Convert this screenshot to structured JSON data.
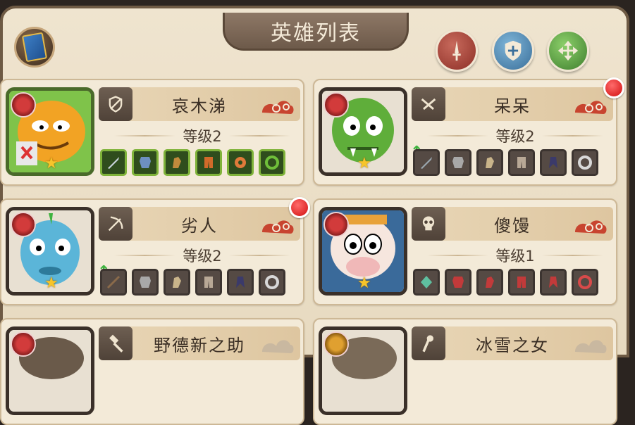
{
  "window": {
    "title": "英雄列表"
  },
  "colors": {
    "accent_green": "#7fb33a",
    "alert_red": "#d10f0f",
    "star": "#f7c52b"
  },
  "toolbar": {
    "buttons": [
      {
        "icon": "sword-icon"
      },
      {
        "icon": "shield-icon"
      },
      {
        "icon": "move-arrows-icon"
      }
    ]
  },
  "heroes": [
    {
      "name": "哀木涕",
      "level": "等级2",
      "class_icon": "shield-class-icon",
      "stars": 1,
      "new": false,
      "items": [
        "sword-item",
        "armor-item",
        "gloves-item",
        "pants-item",
        "gear-item",
        "ring-item"
      ],
      "equipped": [
        true,
        true,
        true,
        true,
        true,
        true
      ]
    },
    {
      "name": "呆呆",
      "level": "等级2",
      "class_icon": "daggers-class-icon",
      "stars": 1,
      "new": true,
      "items": [
        "sword-item",
        "armor-item",
        "gloves-item",
        "pants-item",
        "gear-item",
        "ring-item"
      ],
      "equipped": [
        false,
        false,
        false,
        false,
        false,
        false
      ]
    },
    {
      "name": "劣人",
      "level": "等级2",
      "class_icon": "bow-class-icon",
      "stars": 1,
      "new": true,
      "items": [
        "sword-item",
        "armor-item",
        "gloves-item",
        "pants-item",
        "gear-item",
        "ring-item"
      ],
      "equipped": [
        false,
        false,
        false,
        false,
        false,
        false
      ]
    },
    {
      "name": "傻馒",
      "level": "等级1",
      "class_icon": "skull-class-icon",
      "stars": 1,
      "new": false,
      "items": [
        "sword-item",
        "armor-item",
        "gloves-item",
        "pants-item",
        "gear-item",
        "ring-item"
      ],
      "equipped": [
        false,
        false,
        false,
        false,
        false,
        false
      ]
    },
    {
      "name": "野德新之助",
      "class_icon": "hammer-class-icon"
    },
    {
      "name": "冰雪之女",
      "class_icon": "staff-class-icon"
    }
  ]
}
